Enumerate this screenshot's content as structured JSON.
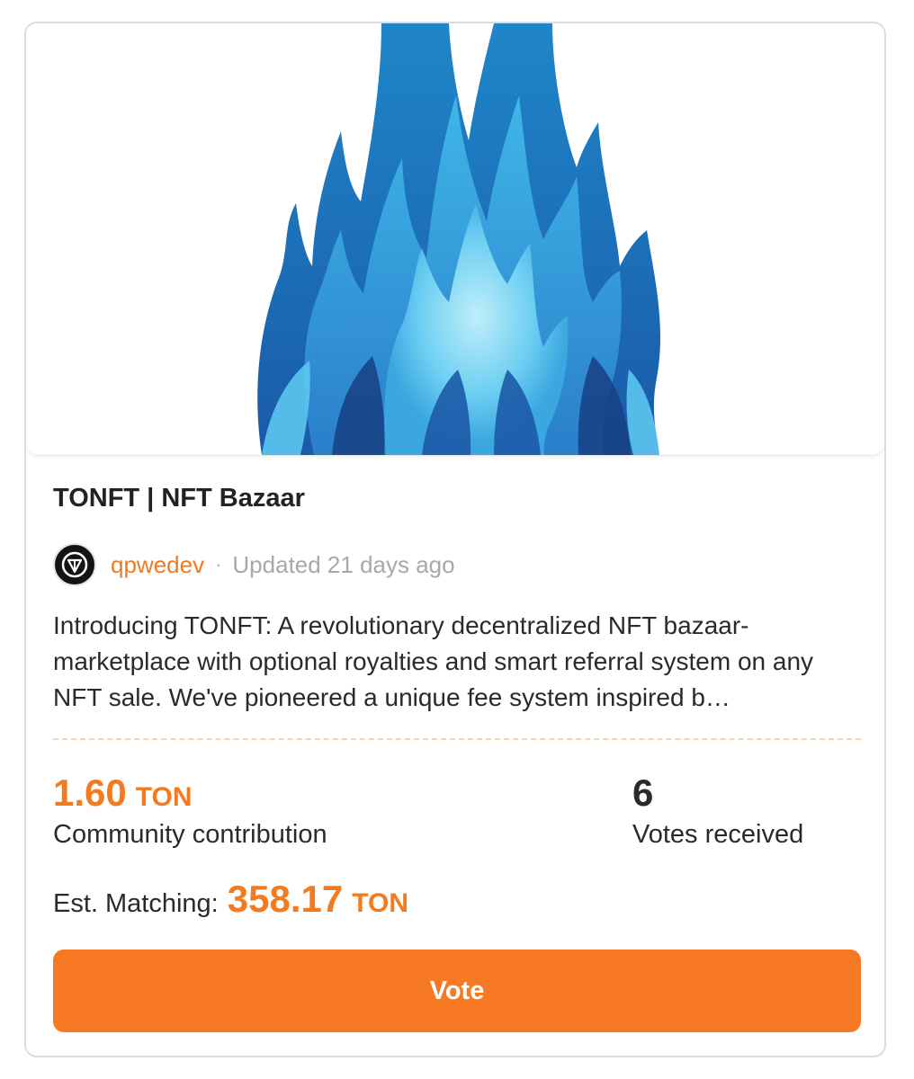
{
  "project": {
    "title": "TONFT | NFT Bazaar",
    "author": "qpwedev",
    "separator": "·",
    "updated": "Updated 21 days ago",
    "description": "Introducing TONFT: A revolutionary decentralized NFT bazaar-marketplace with optional royalties and smart referral system on any NFT sale. We've pioneered a unique fee system inspired b…",
    "cover_icon": "blue-flame-mask-icon",
    "avatar_icon": "tonft-logo-icon"
  },
  "stats": {
    "contribution_value": "1.60",
    "contribution_unit": "TON",
    "contribution_label": "Community contribution",
    "votes_value": "6",
    "votes_label": "Votes received",
    "matching_label": "Est. Matching:",
    "matching_value": "358.17",
    "matching_unit": "TON"
  },
  "actions": {
    "vote_label": "Vote"
  },
  "colors": {
    "accent": "#f87923",
    "author": "#f07a22",
    "text": "#2a2a2a",
    "muted": "#a8a8a8"
  }
}
